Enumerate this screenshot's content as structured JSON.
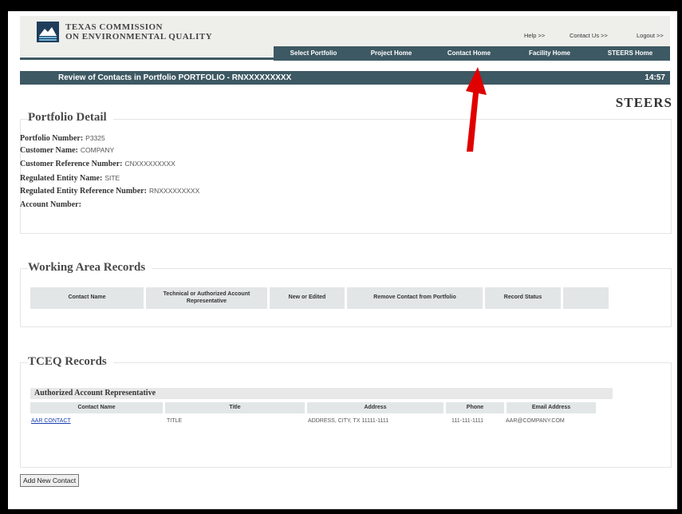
{
  "header": {
    "brand_line1": "TEXAS COMMISSION",
    "brand_line2": "ON ENVIRONMENTAL QUALITY",
    "links": {
      "help": "Help >>",
      "contact_us": "Contact Us >>",
      "logout": "Logout >>"
    },
    "nav": [
      "Select Portfolio",
      "Project Home",
      "Contact Home",
      "Facility Home",
      "STEERS Home"
    ]
  },
  "title_bar": {
    "title": "Review of Contacts in Portfolio PORTFOLIO - RNXXXXXXXXX",
    "time": "14:57"
  },
  "steers_logo_text": "STEERS",
  "portfolio_detail": {
    "title": "Portfolio Detail",
    "rows": [
      {
        "label": "Portfolio Number:",
        "value": "P3325"
      },
      {
        "label": "Customer Name:",
        "value": "COMPANY"
      },
      {
        "label": "Customer Reference Number:",
        "value": "CNXXXXXXXXX"
      },
      {
        "label": "Regulated Entity Name:",
        "value": "SITE"
      },
      {
        "label": "Regulated Entity Reference Number:",
        "value": "RNXXXXXXXXX"
      },
      {
        "label": "Account Number:",
        "value": ""
      }
    ]
  },
  "working_area": {
    "title": "Working Area Records",
    "columns": [
      "Contact Name",
      "Technical or Authorized Account Representative",
      "New or Edited",
      "Remove Contact from Portfolio",
      "Record Status",
      ""
    ]
  },
  "tceq_records": {
    "title": "TCEQ Records",
    "group_title": "Authorized Account Representative",
    "columns": [
      "Contact Name",
      "Title",
      "Address",
      "Phone",
      "Email Address"
    ],
    "rows": [
      {
        "contact": "AAR CONTACT",
        "title": "TITLE",
        "address": "ADDRESS, CITY, TX 11111-1111",
        "phone": "111-111-1111",
        "email": "AAR@COMPANY.COM"
      }
    ]
  },
  "add_button": "Add New Contact",
  "colors": {
    "nav_bg": "#3d5963",
    "annotation_arrow": "#e00000"
  }
}
